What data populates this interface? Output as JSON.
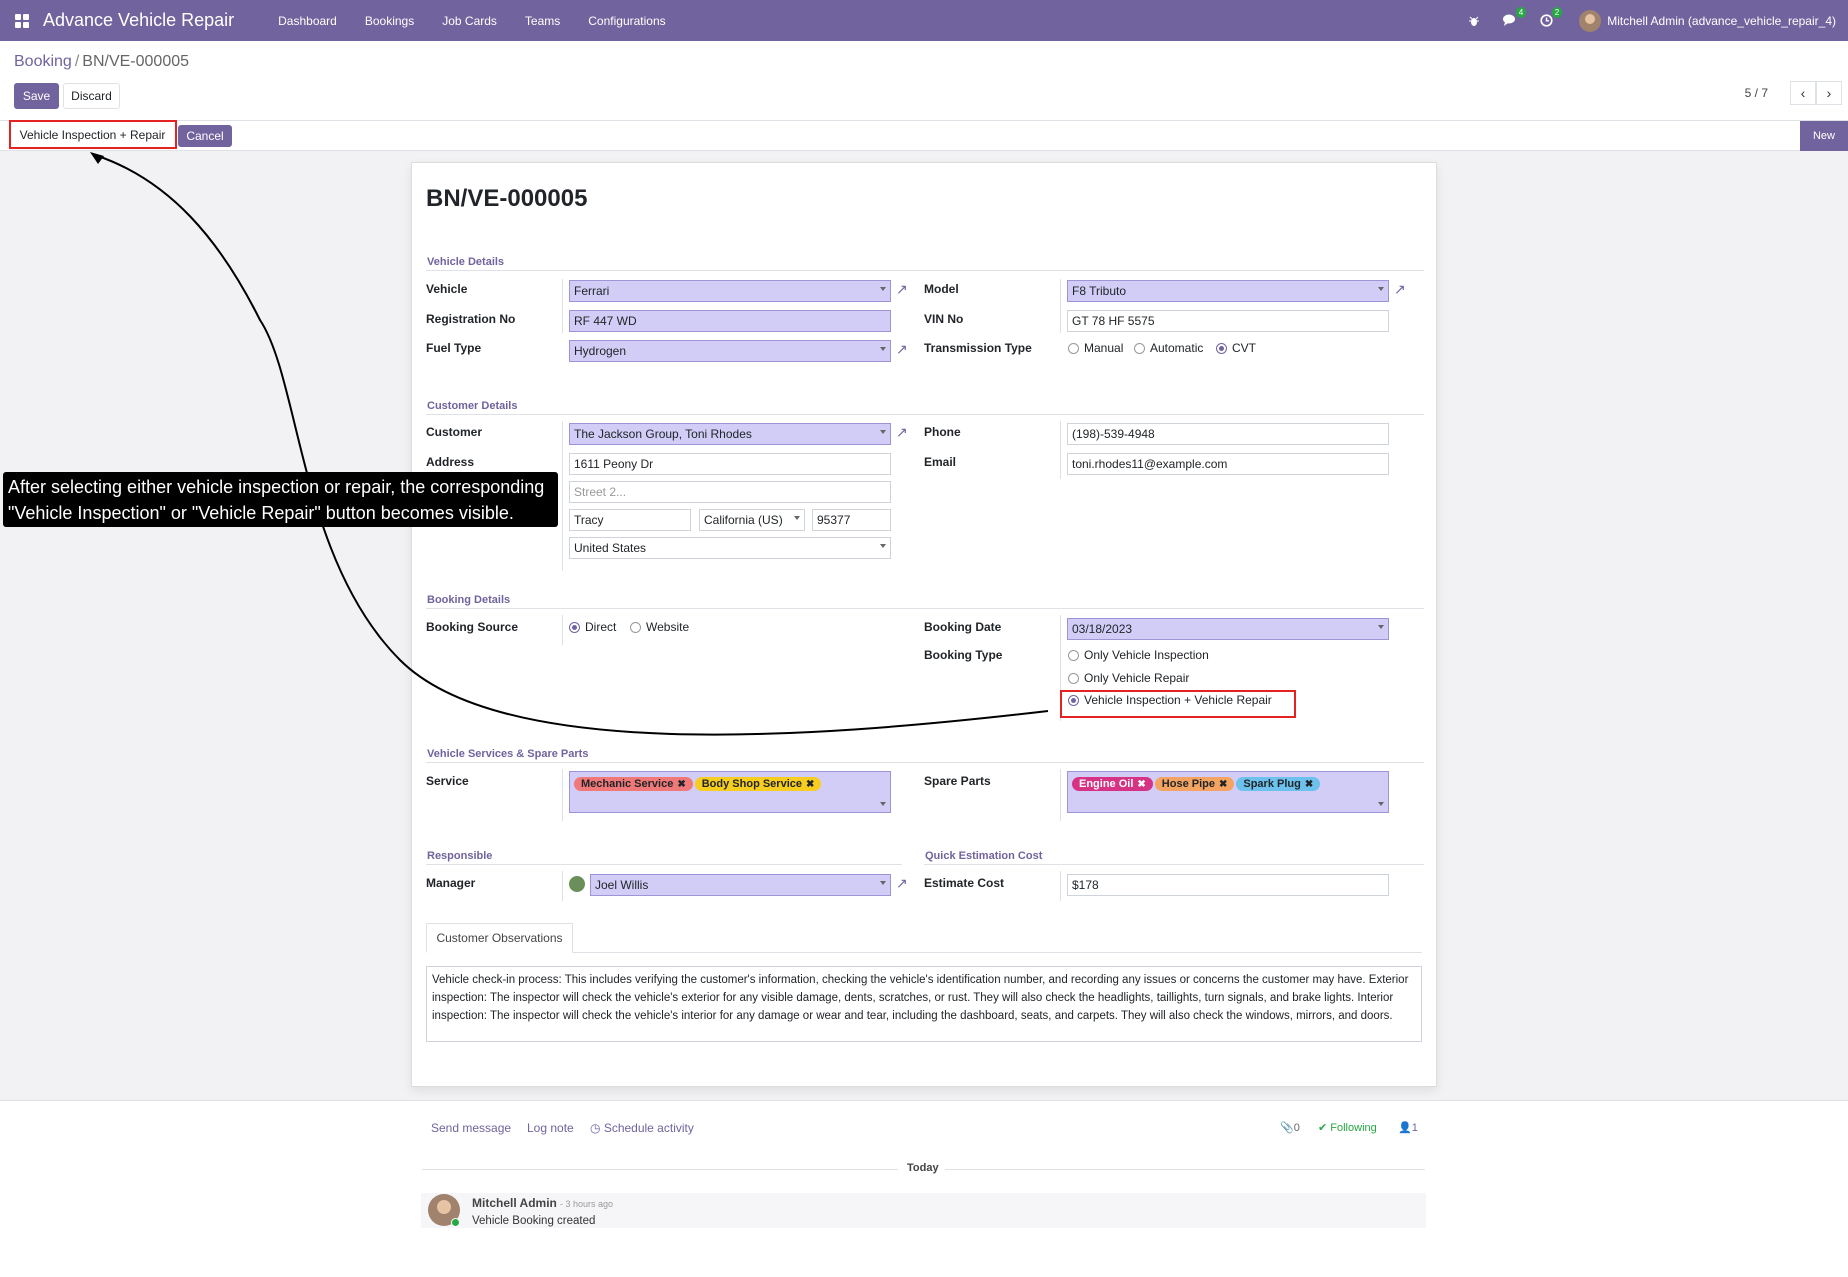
{
  "navbar": {
    "app_title": "Advance Vehicle Repair",
    "menu": [
      "Dashboard",
      "Bookings",
      "Job Cards",
      "Teams",
      "Configurations"
    ],
    "messages_count": "4",
    "activities_count": "2",
    "user": "Mitchell Admin (advance_vehicle_repair_4)"
  },
  "breadcrumb": {
    "parent": "Booking",
    "separator": "/",
    "current": "BN/VE-000005"
  },
  "actions": {
    "save": "Save",
    "discard": "Discard"
  },
  "pager": {
    "value": "5 / 7"
  },
  "statusbar": {
    "primary_action": "Vehicle Inspection + Repair",
    "cancel": "Cancel",
    "stage": "New"
  },
  "form": {
    "title": "BN/VE-000005",
    "vehicle_section": {
      "heading": "Vehicle Details",
      "vehicle_label": "Vehicle",
      "vehicle": "Ferrari",
      "registration_label": "Registration No",
      "registration": "RF 447 WD",
      "fuel_label": "Fuel Type",
      "fuel": "Hydrogen",
      "model_label": "Model",
      "model": "F8 Tributo",
      "vin_label": "VIN No",
      "vin": "GT 78 HF 5575",
      "transmission_label": "Transmission Type",
      "transmission_options": [
        "Manual",
        "Automatic",
        "CVT"
      ],
      "transmission_selected": "CVT"
    },
    "customer_section": {
      "heading": "Customer Details",
      "customer_label": "Customer",
      "customer": "The Jackson Group, Toni Rhodes",
      "address_label": "Address",
      "street": "1611 Peony Dr",
      "street2_placeholder": "Street 2...",
      "city": "Tracy",
      "state": "California (US)",
      "zip": "95377",
      "country": "United States",
      "phone_label": "Phone",
      "phone": "(198)-539-4948",
      "email_label": "Email",
      "email": "toni.rhodes11@example.com"
    },
    "booking_section": {
      "heading": "Booking Details",
      "source_label": "Booking Source",
      "source_options": [
        "Direct",
        "Website"
      ],
      "source_selected": "Direct",
      "date_label": "Booking Date",
      "date": "03/18/2023",
      "type_label": "Booking Type",
      "type_options": [
        "Only Vehicle Inspection",
        "Only Vehicle Repair",
        "Vehicle Inspection + Vehicle Repair"
      ],
      "type_selected": "Vehicle Inspection + Vehicle Repair"
    },
    "services_section": {
      "heading": "Vehicle Services & Spare Parts",
      "service_label": "Service",
      "services": [
        {
          "name": "Mechanic Service",
          "color": "#f07878"
        },
        {
          "name": "Body Shop Service",
          "color": "#f7cd1f"
        }
      ],
      "spare_label": "Spare Parts",
      "spare_parts": [
        {
          "name": "Engine Oil",
          "color": "#d63384",
          "text": "#ffffff"
        },
        {
          "name": "Hose Pipe",
          "color": "#f4a460",
          "text": "#212529"
        },
        {
          "name": "Spark Plug",
          "color": "#6cc1ed",
          "text": "#212529"
        }
      ]
    },
    "responsible_section": {
      "heading": "Responsible",
      "manager_label": "Manager",
      "manager": "Joel Willis"
    },
    "estimation_section": {
      "heading": "Quick Estimation Cost",
      "cost_label": "Estimate Cost",
      "cost": "$178"
    },
    "observations": {
      "tab": "Customer Observations",
      "text": "Vehicle check-in process: This includes verifying the customer's information, checking the vehicle's identification number, and recording any issues or concerns the customer may have. Exterior inspection: The inspector will check the vehicle's exterior for any visible damage, dents, scratches, or rust. They will also check the headlights, taillights, turn signals, and brake lights. Interior inspection: The inspector will check the vehicle's interior for any damage or wear and tear, including the dashboard, seats, and carpets. They will also check the windows, mirrors, and doors."
    }
  },
  "chatter": {
    "send_message": "Send message",
    "log_note": "Log note",
    "schedule_activity": "Schedule activity",
    "attachments": "0",
    "following": "Following",
    "followers": "1",
    "date_separator": "Today",
    "message": {
      "author": "Mitchell Admin",
      "time": "- 3 hours ago",
      "body": "Vehicle Booking created"
    }
  },
  "annotation": {
    "text": "After selecting either vehicle inspection or repair, the corresponding \"Vehicle Inspection\" or \"Vehicle Repair\" button becomes visible."
  },
  "colors": {
    "brand": "#71639e",
    "required_field": "#d2cdf7",
    "highlight": "#e52222"
  }
}
